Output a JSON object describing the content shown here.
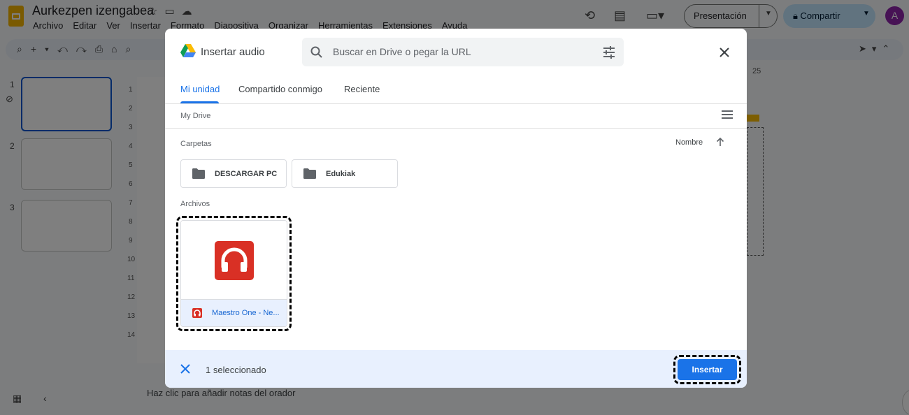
{
  "app": {
    "doc_title": "Aurkezpen izengabea",
    "menu": [
      "Archivo",
      "Editar",
      "Ver",
      "Insertar",
      "Formato",
      "Diapositiva",
      "Organizar",
      "Herramientas",
      "Extensiones",
      "Ayuda"
    ],
    "present_label": "Presentación",
    "share_label": "Compartir",
    "avatar_letter": "A",
    "notes_placeholder": "Haz clic para añadir notas del orador",
    "slide_numbers": [
      "1",
      "2",
      "3"
    ],
    "ruler_right": "25",
    "vruler": [
      "1",
      "2",
      "3",
      "4",
      "5",
      "6",
      "7",
      "8",
      "9",
      "10",
      "11",
      "12",
      "13",
      "14"
    ]
  },
  "dialog": {
    "title": "Insertar audio",
    "search_placeholder": "Buscar en Drive o pegar la URL",
    "tabs": [
      "Mi unidad",
      "Compartido conmigo",
      "Reciente"
    ],
    "active_tab": "Mi unidad",
    "breadcrumb": "My Drive",
    "folders_label": "Carpetas",
    "sort_label": "Nombre",
    "folders": [
      "DESCARGAR PC",
      "Edukiak"
    ],
    "files_label": "Archivos",
    "files": [
      {
        "name": "Maestro One - Ne...",
        "selected": true,
        "icon": "headphones-icon"
      }
    ],
    "footer_text": "1 seleccionado",
    "insert_label": "Insertar"
  },
  "colors": {
    "accent": "#1a73e8",
    "audio_red": "#d93025",
    "overlay": "rgba(0,0,0,0.5)"
  }
}
